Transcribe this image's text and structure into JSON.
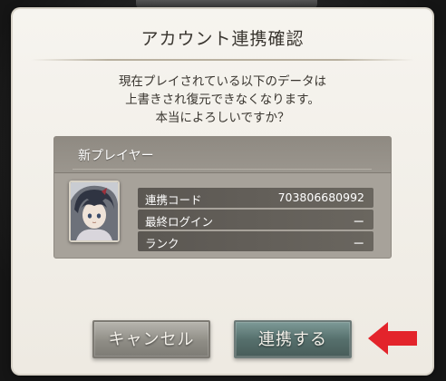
{
  "dialog": {
    "title": "アカウント連携確認",
    "message_lines": [
      "現在プレイされている以下のデータは",
      "上書きされ復元できなくなります。",
      "本当によろしいですか？"
    ]
  },
  "account": {
    "player_name": "新プレイヤー",
    "rows": [
      {
        "label": "連携コード",
        "value": "703806680992"
      },
      {
        "label": "最終ログイン",
        "value": "ー"
      },
      {
        "label": "ランク",
        "value": "ー"
      }
    ]
  },
  "buttons": {
    "cancel_label": "キャンセル",
    "link_label": "連携する"
  },
  "colors": {
    "dialog_bg": "#f2efe9",
    "card_bg": "#a7a29a",
    "row_bg": "#5b5752",
    "confirm_button": "#56706d",
    "annotation_arrow": "#e3242b"
  },
  "icons": {
    "annotation": "red-arrow-icon",
    "avatar": "player-avatar"
  }
}
